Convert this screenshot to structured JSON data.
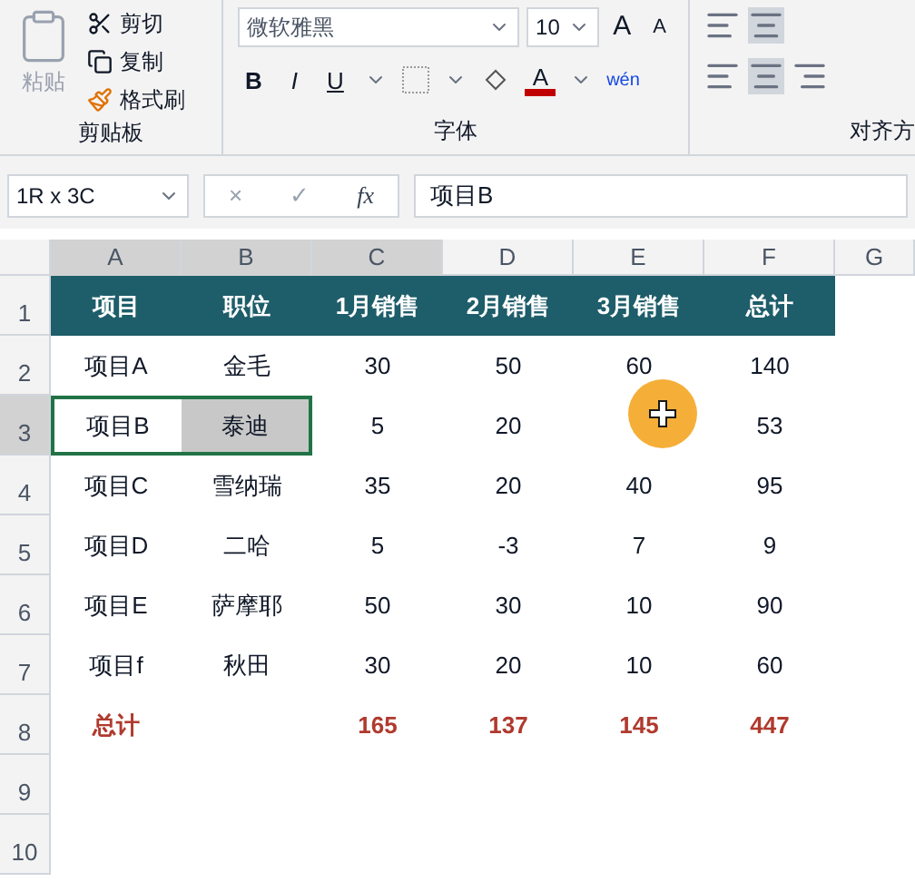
{
  "ribbon": {
    "clipboard": {
      "paste": "粘贴",
      "cut": "剪切",
      "copy": "复制",
      "format_painter": "格式刷",
      "label": "剪贴板"
    },
    "font": {
      "font_name": "微软雅黑",
      "font_size": "10",
      "grow": "A",
      "shrink": "A",
      "bold": "B",
      "italic": "I",
      "underline": "U",
      "font_color": "A",
      "phonetic": "wén",
      "label": "字体"
    },
    "alignment": {
      "label": "对齐方"
    }
  },
  "formula_bar": {
    "name_box": "1R x 3C",
    "cancel": "×",
    "enter": "✓",
    "fx": "fx",
    "value": "项目B"
  },
  "sheet": {
    "columns": [
      {
        "label": "A",
        "selected": true
      },
      {
        "label": "B",
        "selected": true
      },
      {
        "label": "C",
        "selected": true
      },
      {
        "label": "D",
        "selected": false
      },
      {
        "label": "E",
        "selected": false
      },
      {
        "label": "F",
        "selected": false
      },
      {
        "label": "G",
        "selected": false
      }
    ],
    "rows": [
      {
        "number": "1",
        "kind": "header",
        "selected": false,
        "cells": [
          {
            "text": "项目",
            "selected": false
          },
          {
            "text": "职位",
            "selected": false
          },
          {
            "text": "1月销售",
            "selected": false
          },
          {
            "text": "2月销售",
            "selected": false
          },
          {
            "text": "3月销售",
            "selected": false
          },
          {
            "text": "总计",
            "selected": false
          }
        ]
      },
      {
        "number": "2",
        "kind": "data",
        "selected": false,
        "cells": [
          {
            "text": "项目A",
            "selected": false
          },
          {
            "text": "金毛",
            "selected": false
          },
          {
            "text": "30",
            "selected": false
          },
          {
            "text": "50",
            "selected": false
          },
          {
            "text": "60",
            "selected": false
          },
          {
            "text": "140",
            "selected": false
          }
        ]
      },
      {
        "number": "3",
        "kind": "data",
        "selected": true,
        "cells": [
          {
            "text": "项目B",
            "selected": true
          },
          {
            "text": "泰迪",
            "selected": true
          },
          {
            "text": "5",
            "selected": false
          },
          {
            "text": "20",
            "selected": false
          },
          {
            "selected": false
          },
          {
            "text": "53",
            "selected": false
          }
        ]
      },
      {
        "number": "4",
        "kind": "data",
        "selected": false,
        "cells": [
          {
            "text": "项目C",
            "selected": false
          },
          {
            "text": "雪纳瑞",
            "selected": false
          },
          {
            "text": "35",
            "selected": false
          },
          {
            "text": "20",
            "selected": false
          },
          {
            "text": "40",
            "selected": false
          },
          {
            "text": "95",
            "selected": false
          }
        ]
      },
      {
        "number": "5",
        "kind": "data",
        "selected": false,
        "cells": [
          {
            "text": "项目D",
            "selected": false
          },
          {
            "text": "二哈",
            "selected": false
          },
          {
            "text": "5",
            "selected": false
          },
          {
            "text": "-3",
            "selected": false
          },
          {
            "text": "7",
            "selected": false
          },
          {
            "text": "9",
            "selected": false
          }
        ]
      },
      {
        "number": "6",
        "kind": "data",
        "selected": false,
        "cells": [
          {
            "text": "项目E",
            "selected": false
          },
          {
            "text": "萨摩耶",
            "selected": false
          },
          {
            "text": "50",
            "selected": false
          },
          {
            "text": "30",
            "selected": false
          },
          {
            "text": "10",
            "selected": false
          },
          {
            "text": "90",
            "selected": false
          }
        ]
      },
      {
        "number": "7",
        "kind": "data",
        "selected": false,
        "cells": [
          {
            "text": "项目f",
            "selected": false
          },
          {
            "text": "秋田",
            "selected": false
          },
          {
            "text": "30",
            "selected": false
          },
          {
            "text": "20",
            "selected": false
          },
          {
            "text": "10",
            "selected": false
          },
          {
            "text": "60",
            "selected": false
          }
        ]
      },
      {
        "number": "8",
        "kind": "total",
        "selected": false,
        "cells": [
          {
            "text": "总计",
            "selected": false
          },
          {
            "selected": false
          },
          {
            "text": "165",
            "selected": false
          },
          {
            "text": "137",
            "selected": false
          },
          {
            "text": "145",
            "selected": false
          },
          {
            "text": "447",
            "selected": false
          }
        ]
      },
      {
        "number": "9",
        "selected": false,
        "cells": []
      },
      {
        "number": "10",
        "selected": false,
        "cells": []
      }
    ]
  }
}
